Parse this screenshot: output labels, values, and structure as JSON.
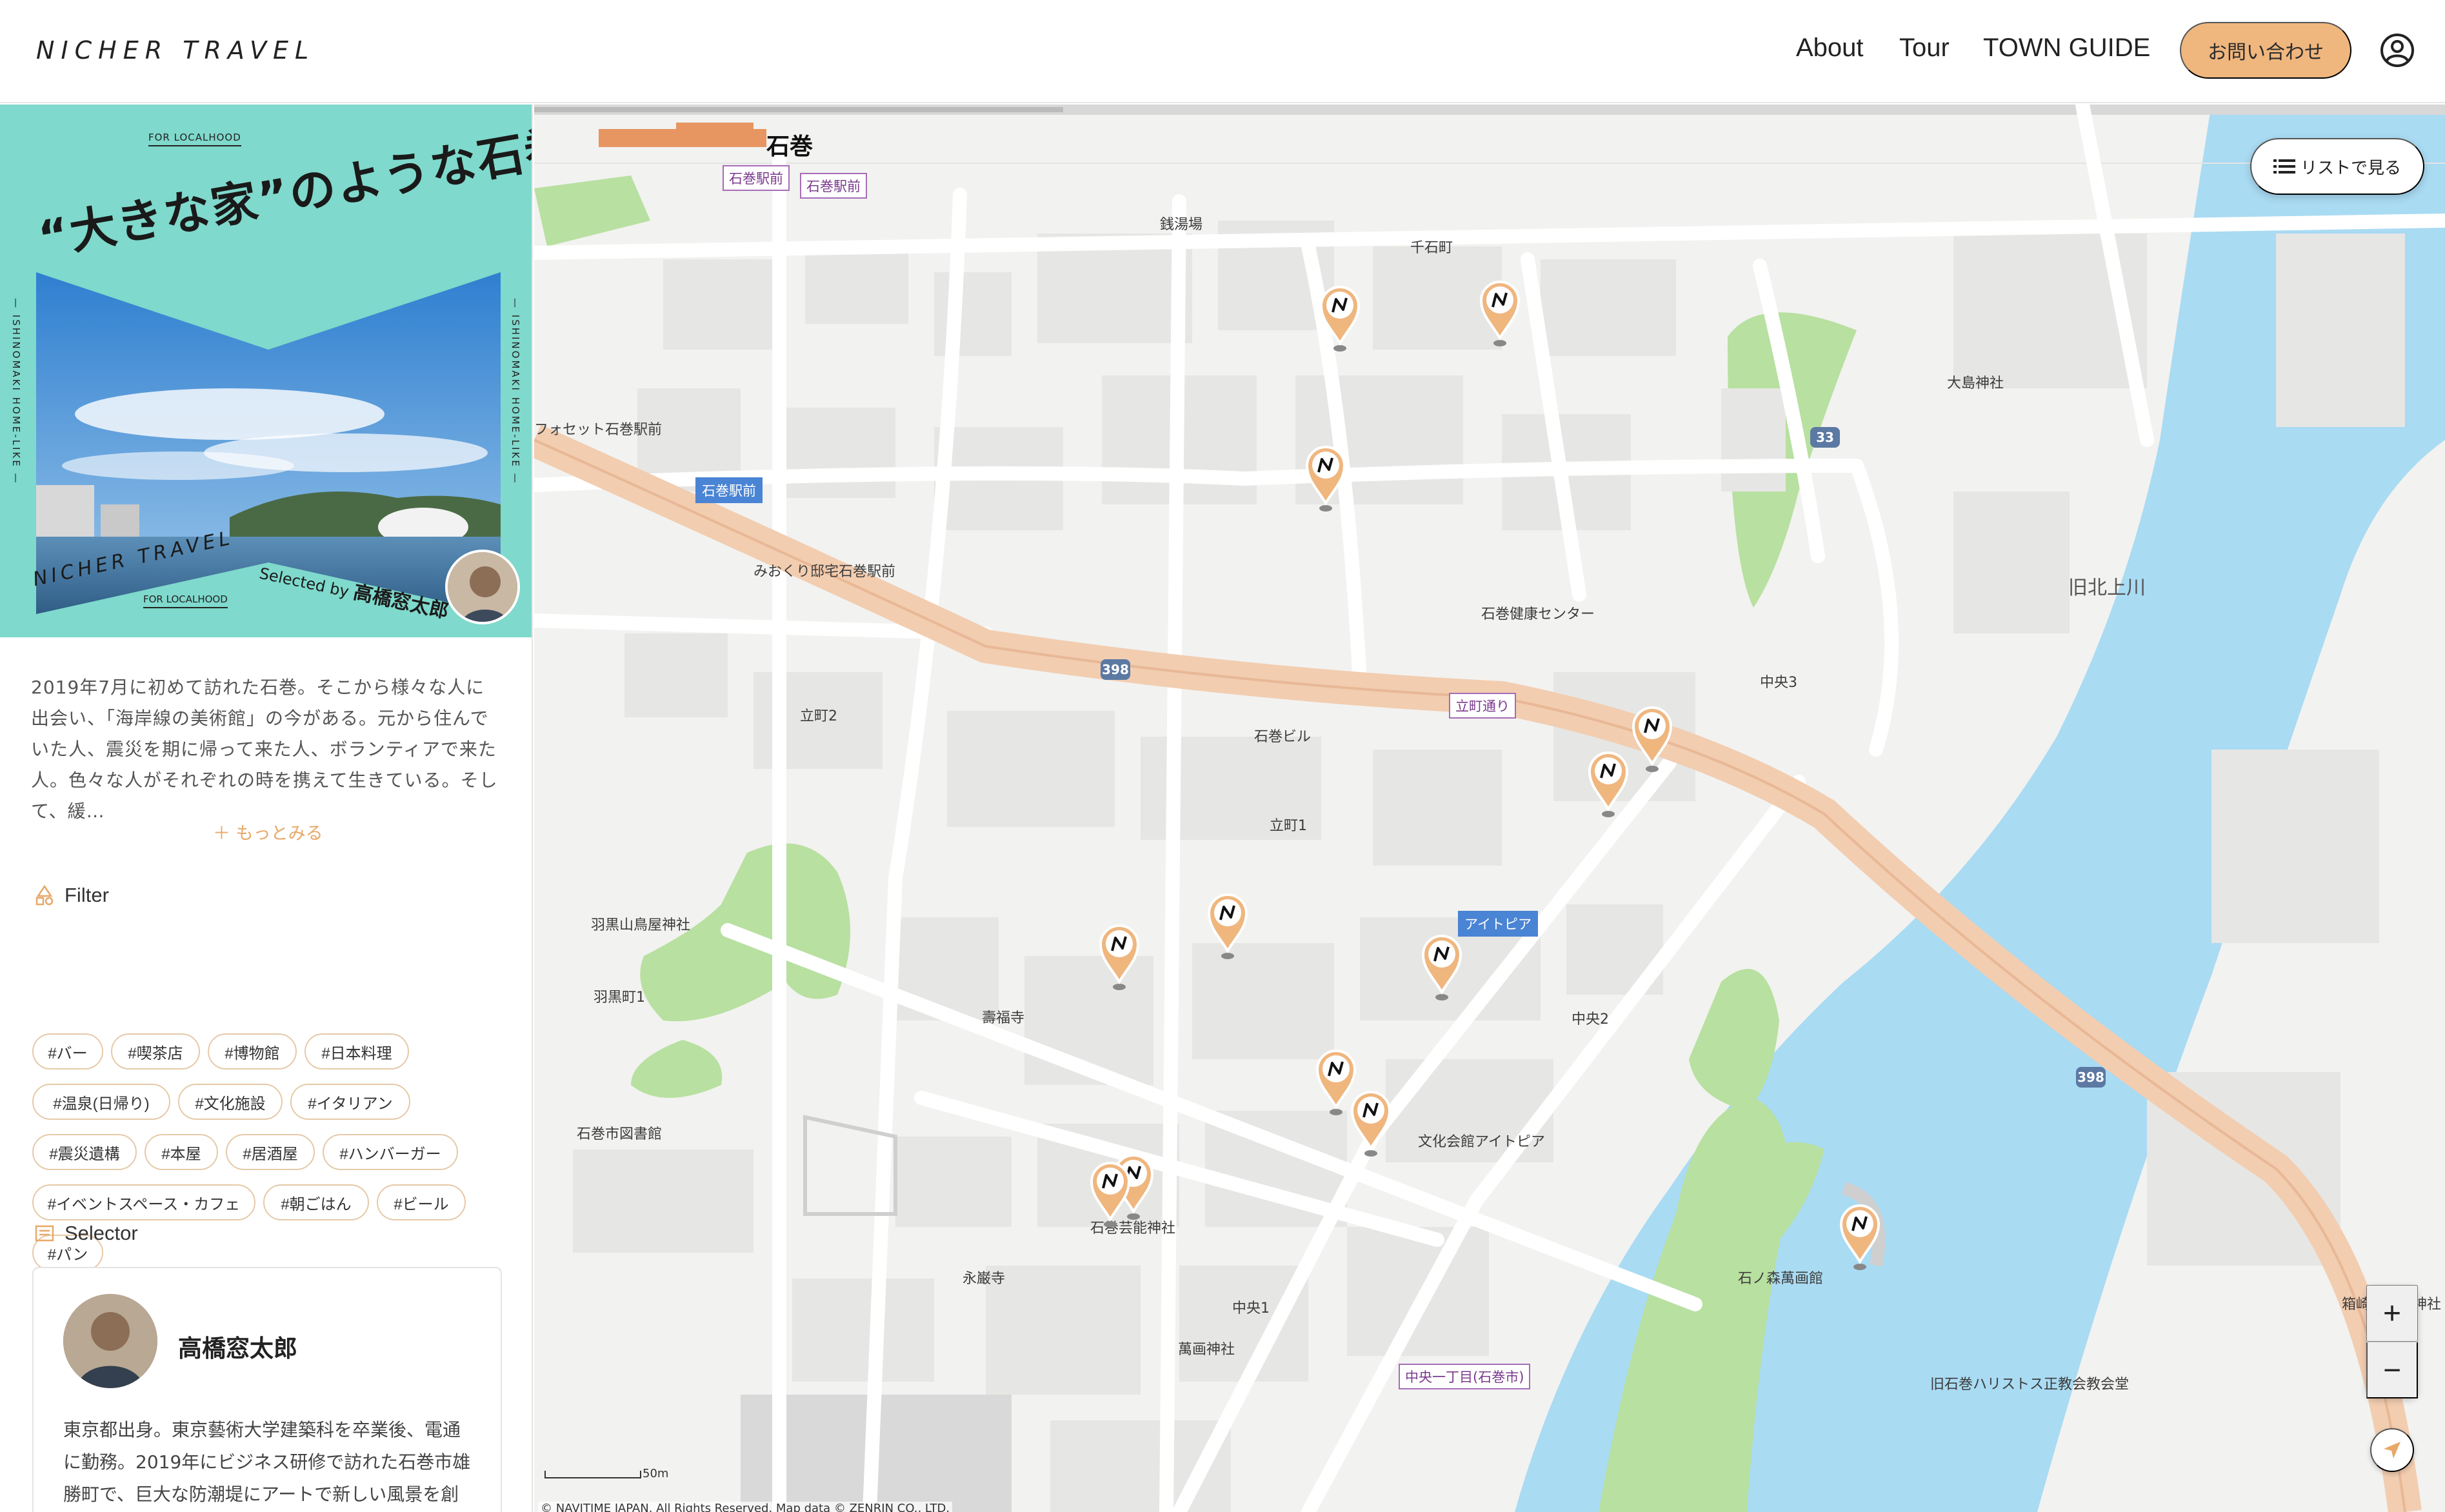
{
  "header": {
    "logo": "NICHER TRAVEL",
    "nav": [
      "About",
      "Tour",
      "TOWN GUIDE"
    ],
    "contact_label": "お問い合わせ",
    "user_icon": "user-circle-icon"
  },
  "cover": {
    "tagline_top": "FOR LOCALHOOD",
    "title": "“大きな家”のような石巻",
    "side_text": "— ISHINOMAKI HOME-LIKE —",
    "brand": "NICHER TRAVEL",
    "tagline_bottom": "FOR LOCALHOOD",
    "selected_by": "Selected by",
    "selector_name": "高橋窓太郎"
  },
  "description": "2019年7月に初めて訪れた石巻。そこから様々な人に出会い、「海岸線の美術館」の今がある。元から住んでいた人、震災を期に帰って来た人、ボランティアで来た人。色々な人がそれぞれの時を携えて生きている。そして、緩…",
  "more_label": "＋ もっとみる",
  "filter": {
    "label": "Filter",
    "icon": "shapes-icon",
    "tags": [
      "#バー",
      "#喫茶店",
      "#博物館",
      "#日本料理",
      "#温泉(日帰り)",
      "#文化施設",
      "#イタリアン",
      "#震災遺構",
      "#本屋",
      "#居酒屋",
      "#ハンバーガー",
      "#イベントスペース・カフェ",
      "#朝ごはん",
      "#ビール",
      "#パン"
    ]
  },
  "selector": {
    "label": "Selector",
    "icon": "list-card-icon",
    "name": "高橋窓太郎",
    "bio": "東京都出身。東京藝術大学建築科を卒業後、電通に勤務。2019年にビジネス研修で訪れた石巻市雄勝町で、巨大な防潮堤にアートで新しい風景を創"
  },
  "map": {
    "list_button": "リストで見る",
    "station": "石巻",
    "labels": {
      "senzeniba": "銭湯場",
      "sengokucho": "千石町",
      "oshimajinja": "大島神社",
      "fosset": "フォセット石巻駅前",
      "miokuri": "みおくり邸宅石巻駅前",
      "kenko": "石巻健康センター",
      "kitakami": "旧北上川",
      "chuo3": "中央3",
      "tachimachi2": "立町2",
      "ishinomakibldg": "石巻ビル",
      "tachimachi1": "立町1",
      "haguro_shrine": "羽黒山鳥屋神社",
      "haguro1": "羽黒町1",
      "jufukuji": "壽福寺",
      "chuo2": "中央2",
      "library": "石巻市図書館",
      "bunka": "文化会館アイトピア",
      "geino": "石巻芸能神社",
      "eiganji": "永巌寺",
      "chuo1": "中央1",
      "mangoku": "萬画神社",
      "mangakan": "石ノ森萬画館",
      "hakozaki": "箱崎八幡宮神社",
      "harist": "旧石巻ハリストス正教会教会堂"
    },
    "bus_stops": {
      "ekimae_a": "石巻駅前",
      "ekimae_b": "石巻駅前",
      "ekimae_blue": "石巻駅前",
      "tachimachi": "立町通り",
      "aitopia": "アイトピア",
      "chuo1chome": "中央一丁目(石巻市)"
    },
    "routes": [
      "33",
      "398",
      "398"
    ],
    "scale": "50m",
    "copyright": "© NAVITIME JAPAN, All Rights Reserved. Map data © ZENRIN CO., LTD.",
    "zoom_in": "+",
    "zoom_out": "−",
    "pin_icon": "nicher-pin-icon",
    "pin_count": 14,
    "colors": {
      "pin": "#efb67e",
      "river": "#a9dbf3",
      "park": "#b8e0a0",
      "road_major": "#f2cdb0"
    }
  },
  "colors": {
    "accent": "#efb67e",
    "cover_bg": "#7fd9cc",
    "tag_border": "#e6c9a8"
  }
}
